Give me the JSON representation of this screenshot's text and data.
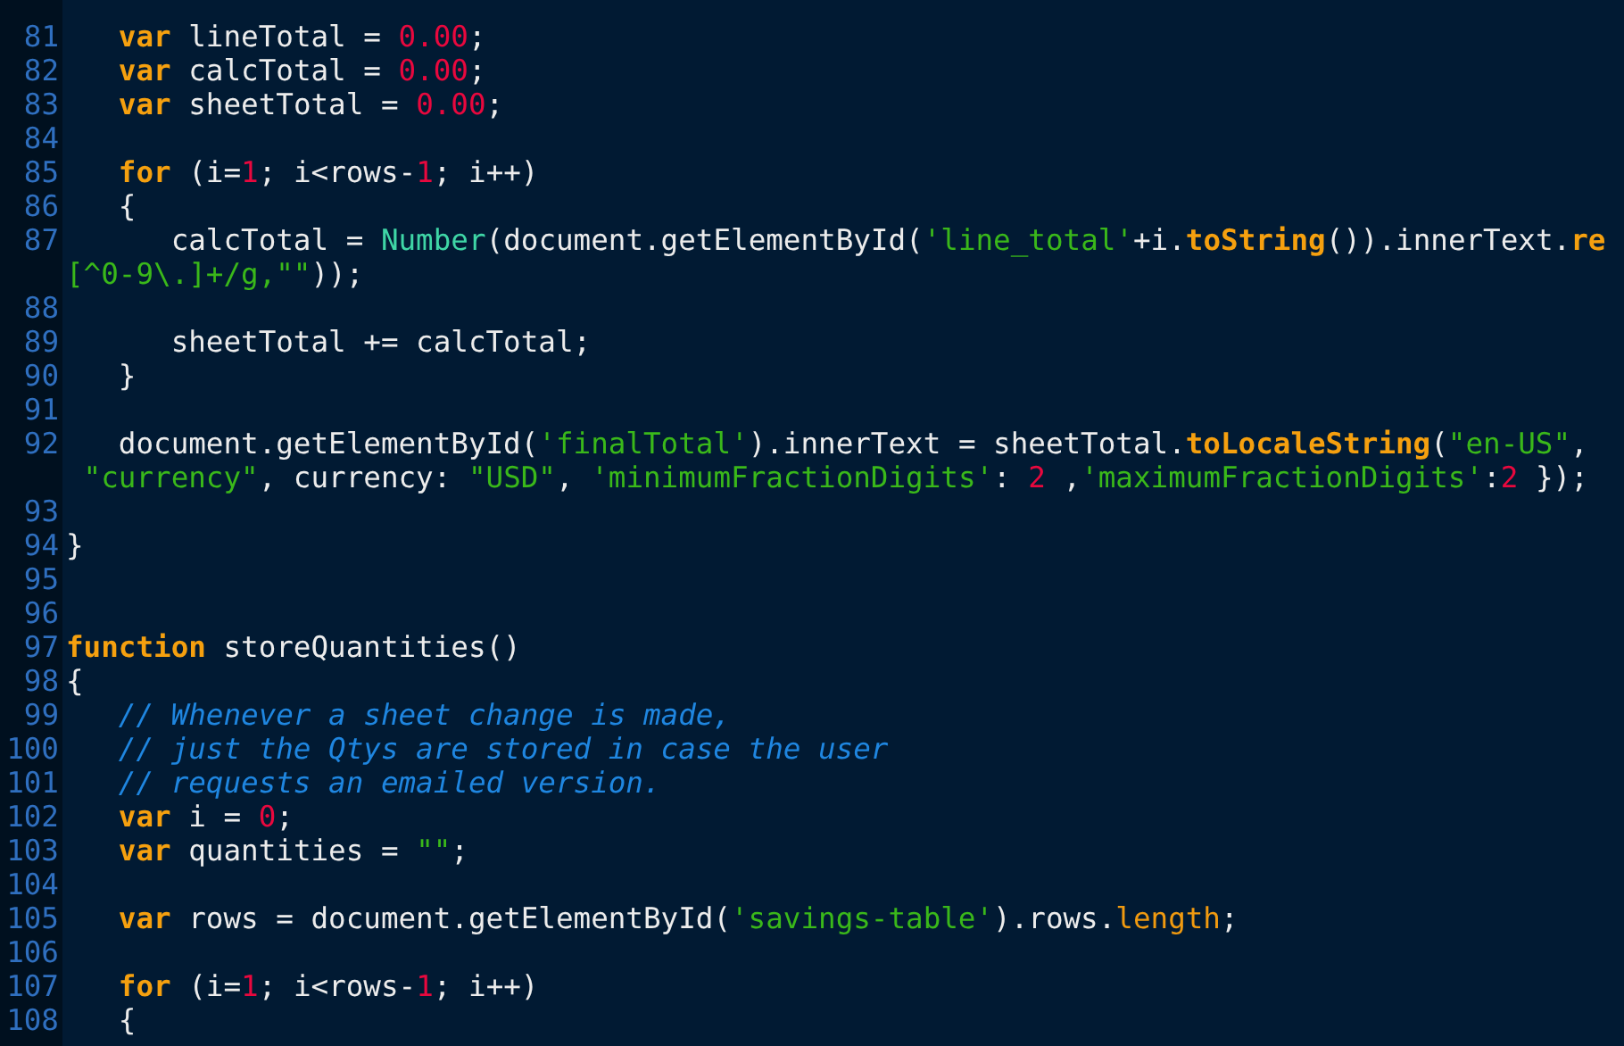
{
  "editor": {
    "lines": [
      {
        "number": "81",
        "tokens": [
          {
            "kind": "keyword",
            "text": "   var"
          },
          {
            "kind": "plain",
            "text": " lineTotal = "
          },
          {
            "kind": "number",
            "text": "0.00"
          },
          {
            "kind": "plain",
            "text": ";"
          }
        ]
      },
      {
        "number": "82",
        "tokens": [
          {
            "kind": "keyword",
            "text": "   var"
          },
          {
            "kind": "plain",
            "text": " calcTotal = "
          },
          {
            "kind": "number",
            "text": "0.00"
          },
          {
            "kind": "plain",
            "text": ";"
          }
        ]
      },
      {
        "number": "83",
        "tokens": [
          {
            "kind": "keyword",
            "text": "   var"
          },
          {
            "kind": "plain",
            "text": " sheetTotal = "
          },
          {
            "kind": "number",
            "text": "0.00"
          },
          {
            "kind": "plain",
            "text": ";"
          }
        ]
      },
      {
        "number": "84"
      },
      {
        "number": "85",
        "tokens": [
          {
            "kind": "keyword",
            "text": "   for"
          },
          {
            "kind": "plain",
            "text": " (i="
          },
          {
            "kind": "number",
            "text": "1"
          },
          {
            "kind": "plain",
            "text": "; i<rows-"
          },
          {
            "kind": "number",
            "text": "1"
          },
          {
            "kind": "plain",
            "text": "; i++)"
          }
        ]
      },
      {
        "number": "86",
        "tokens": [
          {
            "kind": "plain",
            "text": "   {"
          }
        ]
      },
      {
        "number": "87",
        "tokens": [
          {
            "kind": "plain",
            "text": "      calcTotal = "
          },
          {
            "kind": "builtin",
            "text": "Number"
          },
          {
            "kind": "plain",
            "text": "(document.getElementById("
          },
          {
            "kind": "string",
            "text": "'line_total'"
          },
          {
            "kind": "plain",
            "text": "+i."
          },
          {
            "kind": "method",
            "text": "toString"
          },
          {
            "kind": "plain",
            "text": "()).innerText."
          },
          {
            "kind": "method",
            "text": "re"
          }
        ],
        "continuation": {
          "tokens": [
            {
              "kind": "string",
              "text": "[^0-9\\.]+/g,\"\""
            },
            {
              "kind": "plain",
              "text": "));"
            }
          ]
        }
      },
      {
        "number": "88"
      },
      {
        "number": "89",
        "tokens": [
          {
            "kind": "plain",
            "text": "      sheetTotal += calcTotal;"
          }
        ]
      },
      {
        "number": "90",
        "tokens": [
          {
            "kind": "plain",
            "text": "   }"
          }
        ]
      },
      {
        "number": "91"
      },
      {
        "number": "92",
        "tokens": [
          {
            "kind": "plain",
            "text": "   document.getElementById("
          },
          {
            "kind": "string",
            "text": "'finalTotal'"
          },
          {
            "kind": "plain",
            "text": ").innerText = sheetTotal."
          },
          {
            "kind": "method",
            "text": "toLocaleString"
          },
          {
            "kind": "plain",
            "text": "("
          },
          {
            "kind": "string",
            "text": "\"en-US\""
          },
          {
            "kind": "plain",
            "text": ","
          }
        ],
        "continuation": {
          "tokens": [
            {
              "kind": "string",
              "text": " \"currency\""
            },
            {
              "kind": "plain",
              "text": ", currency: "
            },
            {
              "kind": "string",
              "text": "\"USD\""
            },
            {
              "kind": "plain",
              "text": ", "
            },
            {
              "kind": "string",
              "text": "'minimumFractionDigits'"
            },
            {
              "kind": "plain",
              "text": ": "
            },
            {
              "kind": "number",
              "text": "2"
            },
            {
              "kind": "plain",
              "text": " ,"
            },
            {
              "kind": "string",
              "text": "'maximumFractionDigits'"
            },
            {
              "kind": "plain",
              "text": ":"
            },
            {
              "kind": "number",
              "text": "2"
            },
            {
              "kind": "plain",
              "text": " });"
            }
          ]
        }
      },
      {
        "number": "93"
      },
      {
        "number": "94",
        "tokens": [
          {
            "kind": "plain",
            "text": "}"
          }
        ]
      },
      {
        "number": "95"
      },
      {
        "number": "96"
      },
      {
        "number": "97",
        "tokens": [
          {
            "kind": "keyword",
            "text": "function"
          },
          {
            "kind": "plain",
            "text": " storeQuantities()"
          }
        ]
      },
      {
        "number": "98",
        "tokens": [
          {
            "kind": "plain",
            "text": "{"
          }
        ]
      },
      {
        "number": "99",
        "tokens": [
          {
            "kind": "comment",
            "text": "   // Whenever a sheet change is made,"
          }
        ]
      },
      {
        "number": "100",
        "tokens": [
          {
            "kind": "comment",
            "text": "   // just the Qtys are stored in case the user"
          }
        ]
      },
      {
        "number": "101",
        "tokens": [
          {
            "kind": "comment",
            "text": "   // requests an emailed version."
          }
        ]
      },
      {
        "number": "102",
        "tokens": [
          {
            "kind": "keyword",
            "text": "   var"
          },
          {
            "kind": "plain",
            "text": " i = "
          },
          {
            "kind": "number",
            "text": "0"
          },
          {
            "kind": "plain",
            "text": ";"
          }
        ]
      },
      {
        "number": "103",
        "tokens": [
          {
            "kind": "keyword",
            "text": "   var"
          },
          {
            "kind": "plain",
            "text": " quantities = "
          },
          {
            "kind": "string",
            "text": "\"\""
          },
          {
            "kind": "plain",
            "text": ";"
          }
        ]
      },
      {
        "number": "104"
      },
      {
        "number": "105",
        "tokens": [
          {
            "kind": "keyword",
            "text": "   var"
          },
          {
            "kind": "plain",
            "text": " rows = document.getElementById("
          },
          {
            "kind": "string",
            "text": "'savings-table'"
          },
          {
            "kind": "plain",
            "text": ").rows."
          },
          {
            "kind": "property",
            "text": "length"
          },
          {
            "kind": "plain",
            "text": ";"
          }
        ]
      },
      {
        "number": "106"
      },
      {
        "number": "107",
        "tokens": [
          {
            "kind": "keyword",
            "text": "   for"
          },
          {
            "kind": "plain",
            "text": " (i="
          },
          {
            "kind": "number",
            "text": "1"
          },
          {
            "kind": "plain",
            "text": "; i<rows-"
          },
          {
            "kind": "number",
            "text": "1"
          },
          {
            "kind": "plain",
            "text": "; i++)"
          }
        ]
      },
      {
        "number": "108",
        "tokens": [
          {
            "kind": "plain",
            "text": "   {"
          }
        ]
      }
    ]
  }
}
